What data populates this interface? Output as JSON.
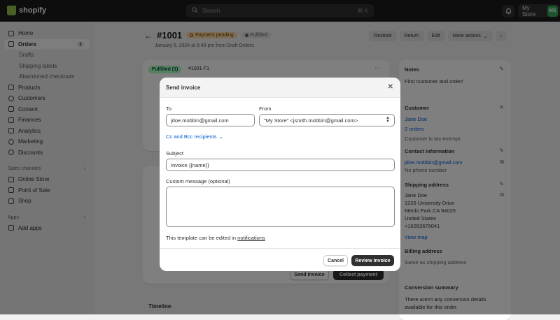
{
  "topbar": {
    "brand": "shopify",
    "search_placeholder": "Search",
    "search_shortcut": "⌘ K",
    "store_name": "My Store",
    "store_initials": "MS"
  },
  "sidebar": {
    "items": [
      {
        "label": "Home",
        "icon": "home-icon"
      },
      {
        "label": "Orders",
        "icon": "orders-icon",
        "badge": "1",
        "active": true
      },
      {
        "label": "Drafts",
        "sub": true
      },
      {
        "label": "Shipping labels",
        "sub": true
      },
      {
        "label": "Abandoned checkouts",
        "sub": true
      },
      {
        "label": "Products",
        "icon": "tag-icon"
      },
      {
        "label": "Customers",
        "icon": "person-icon"
      },
      {
        "label": "Content",
        "icon": "content-icon"
      },
      {
        "label": "Finances",
        "icon": "bank-icon"
      },
      {
        "label": "Analytics",
        "icon": "chart-icon"
      },
      {
        "label": "Marketing",
        "icon": "target-icon"
      },
      {
        "label": "Discounts",
        "icon": "discount-icon"
      }
    ],
    "sales_channels_heading": "Sales channels",
    "channels": [
      {
        "label": "Online Store",
        "icon": "store-icon"
      },
      {
        "label": "Point of Sale",
        "icon": "pos-icon"
      },
      {
        "label": "Shop",
        "icon": "shop-icon"
      }
    ],
    "apps_heading": "Apps",
    "add_apps": "Add apps"
  },
  "order": {
    "title": "#1001",
    "payment_badge": "Payment pending",
    "fulfillment_badge": "Fulfilled",
    "subline": "January 6, 2024 at 9:48 pm from Draft Orders",
    "actions": [
      "Restock",
      "Return",
      "Edit",
      "More actions"
    ],
    "fulfilled_chip": "Fulfilled (1)",
    "fulfillment_id": "#1001-F1",
    "send_invoice": "Send invoice",
    "collect_payment": "Collect payment",
    "timeline": "Timeline"
  },
  "right": {
    "notes_title": "Notes",
    "notes_text": "First customer and order!",
    "customer_title": "Customer",
    "customer_name": "Jane Doe",
    "customer_orders": "2 orders",
    "customer_tax": "Customer is tax-exempt",
    "contact_title": "Contact information",
    "contact_email": "jdoe.mobbin@gmail.com",
    "contact_phone": "No phone number",
    "shipping_title": "Shipping address",
    "shipping_lines": [
      "Jane Doe",
      "1226 University Drive",
      "Menlo Park CA 94025",
      "United States",
      "+16282679041"
    ],
    "view_map": "View map",
    "billing_title": "Billing address",
    "billing_text": "Same as shipping address",
    "conversion_title": "Conversion summary",
    "conversion_text": "There aren't any conversion details available for this order."
  },
  "modal": {
    "title": "Send invoice",
    "to_label": "To",
    "to_value": "jdoe.mobbin@gmail.com",
    "from_label": "From",
    "from_value": "\"My Store\" <jsmith.mobbin@gmail.com>",
    "cc_link": "Cc and Bcc recipients",
    "subject_label": "Subject",
    "subject_value": "Invoice {{name}}",
    "message_label": "Custom message (optional)",
    "message_value": "",
    "template_note_prefix": "This template can be edited in ",
    "template_note_link": "notifications",
    "cancel": "Cancel",
    "review": "Review invoice"
  }
}
